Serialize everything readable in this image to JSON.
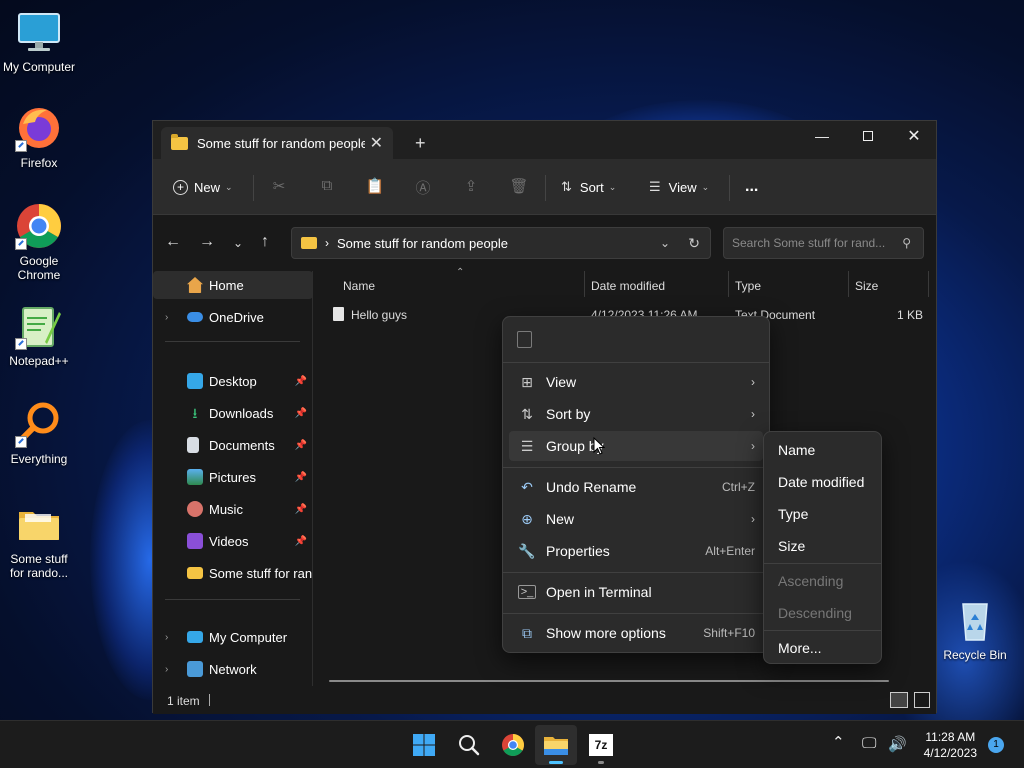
{
  "desktop": {
    "icons": [
      {
        "label": "My Computer"
      },
      {
        "label": "Firefox"
      },
      {
        "label": "Google Chrome"
      },
      {
        "label": "Notepad++"
      },
      {
        "label": "Everything"
      },
      {
        "label": "Some stuff for rando..."
      },
      {
        "label": "Recycle Bin"
      }
    ]
  },
  "explorer": {
    "tab_title": "Some stuff for random people",
    "toolbar": {
      "new": "New",
      "sort": "Sort",
      "view": "View",
      "more": "..."
    },
    "address": {
      "path": "Some stuff for random people"
    },
    "search": {
      "placeholder": "Search Some stuff for rand..."
    },
    "sidebar": {
      "home": "Home",
      "onedrive": "OneDrive",
      "quick": [
        {
          "label": "Desktop"
        },
        {
          "label": "Downloads"
        },
        {
          "label": "Documents"
        },
        {
          "label": "Pictures"
        },
        {
          "label": "Music"
        },
        {
          "label": "Videos"
        },
        {
          "label": "Some stuff for rand"
        }
      ],
      "my_computer": "My Computer",
      "network": "Network"
    },
    "columns": {
      "name": "Name",
      "date": "Date modified",
      "type": "Type",
      "size": "Size"
    },
    "files": [
      {
        "name": "Hello guys",
        "date": "4/12/2023 11:26 AM",
        "type": "Text Document",
        "size": "1 KB"
      }
    ],
    "status": "1 item"
  },
  "context_menu": {
    "items": [
      {
        "label": "View"
      },
      {
        "label": "Sort by"
      },
      {
        "label": "Group by"
      },
      {
        "label": "Undo Rename",
        "shortcut": "Ctrl+Z"
      },
      {
        "label": "New"
      },
      {
        "label": "Properties",
        "shortcut": "Alt+Enter"
      },
      {
        "label": "Open in Terminal"
      },
      {
        "label": "Show more options",
        "shortcut": "Shift+F10"
      }
    ]
  },
  "group_submenu": {
    "items": [
      {
        "label": "Name"
      },
      {
        "label": "Date modified"
      },
      {
        "label": "Type"
      },
      {
        "label": "Size"
      },
      {
        "label": "Ascending"
      },
      {
        "label": "Descending"
      },
      {
        "label": "More..."
      }
    ]
  },
  "taskbar": {
    "time": "11:28 AM",
    "date": "4/12/2023",
    "notification_count": "1",
    "apps": [
      {
        "name": "start-icon"
      },
      {
        "name": "search-icon"
      },
      {
        "name": "chrome-icon"
      },
      {
        "name": "file-explorer-icon"
      },
      {
        "name": "7zip-icon",
        "label": "7z"
      }
    ]
  },
  "colors": {
    "accent": "#4cc2ff",
    "folder": "#f5c443",
    "menu_bg": "#2b2b2b"
  }
}
